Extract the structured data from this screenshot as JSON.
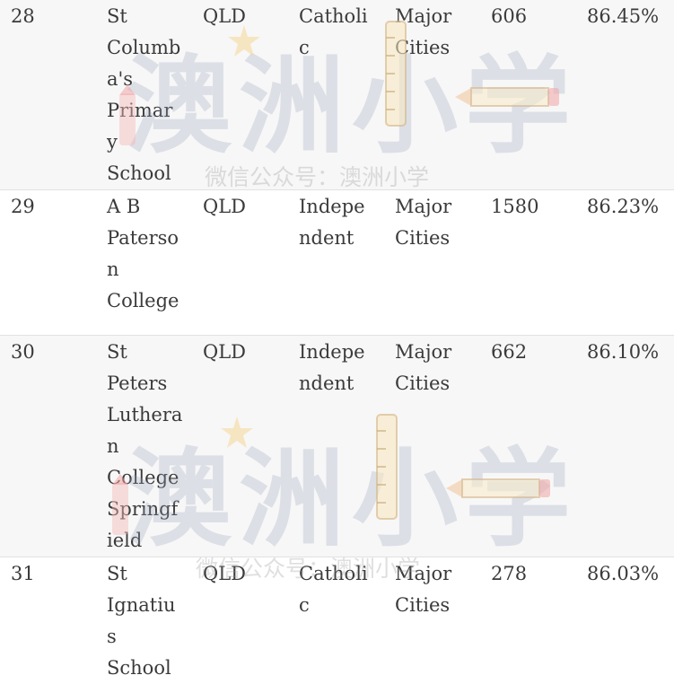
{
  "table": {
    "rows": [
      {
        "rank": "28",
        "name": "St Columba's Primary School",
        "state": "QLD",
        "sector": "Catholic",
        "location": "Major Cities",
        "enrolments": "606",
        "score": "86.45%"
      },
      {
        "rank": "29",
        "name": "A B Paterson College",
        "state": "QLD",
        "sector": "Independent",
        "location": "Major Cities",
        "enrolments": "1580",
        "score": "86.23%"
      },
      {
        "rank": "30",
        "name": "St Peters Lutheran College Springfield",
        "state": "QLD",
        "sector": "Independent",
        "location": "Major Cities",
        "enrolments": "662",
        "score": "86.10%"
      },
      {
        "rank": "31",
        "name": "St Ignatius School",
        "state": "QLD",
        "sector": "Catholic",
        "location": "Major Cities",
        "enrolments": "278",
        "score": "86.03%"
      }
    ]
  },
  "watermark": {
    "brand": "澳洲小学",
    "caption": "微信公众号：澳洲小学"
  }
}
